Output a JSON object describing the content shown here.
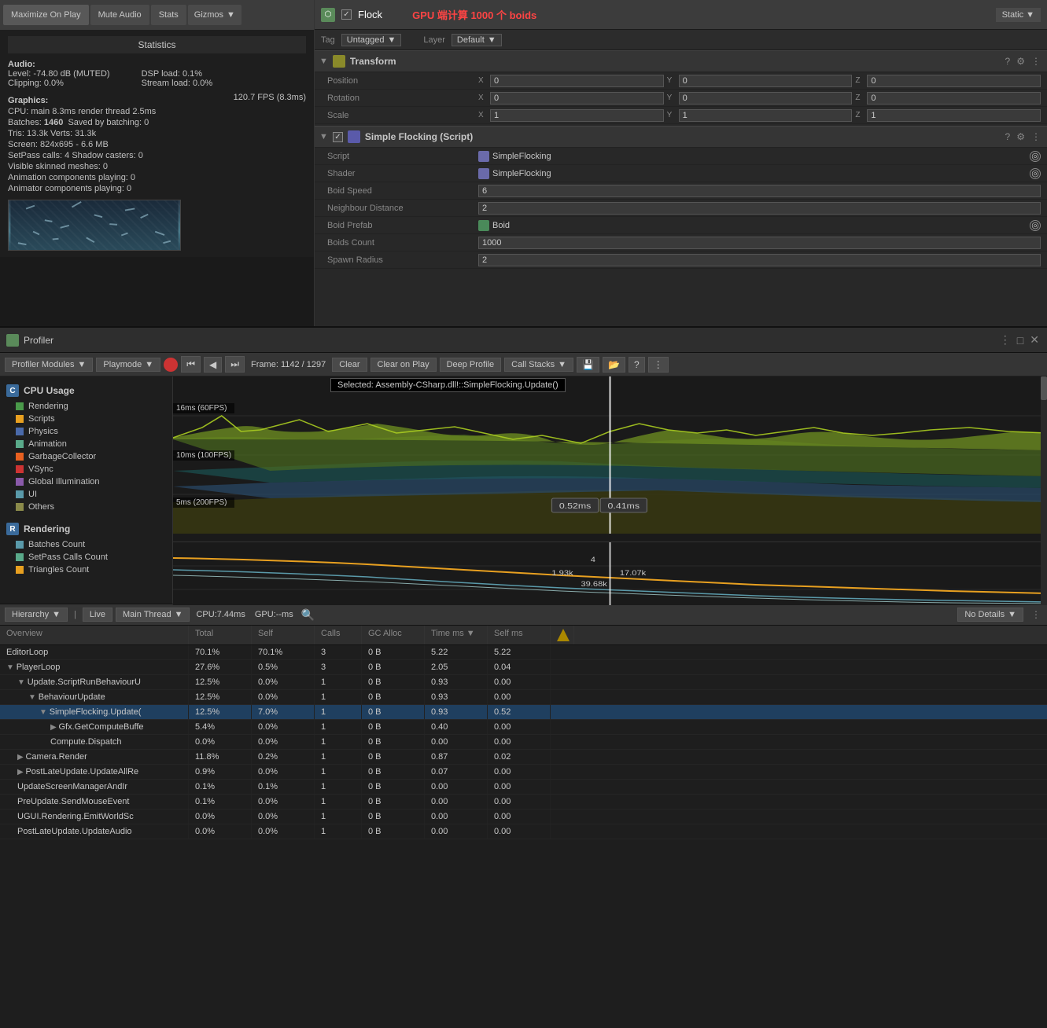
{
  "toolbar": {
    "maximize_on_play": "Maximize On Play",
    "mute_audio": "Mute Audio",
    "stats": "Stats",
    "gizmos": "Gizmos"
  },
  "statistics": {
    "title": "Statistics",
    "audio_label": "Audio:",
    "audio_level": "Level: -74.80 dB (MUTED)",
    "audio_clipping": "Clipping: 0.0%",
    "audio_dsp": "DSP load: 0.1%",
    "audio_stream": "Stream load: 0.0%",
    "graphics_label": "Graphics:",
    "graphics_fps": "120.7 FPS (8.3ms)",
    "cpu_line": "CPU: main 8.3ms  render thread 2.5ms",
    "batches_line": "Batches: 1460  Saved by batching: 0",
    "tris_verts": "Tris: 13.3k     Verts: 31.3k",
    "screen": "Screen: 824x695 - 6.6 MB",
    "setpass": "SetPass calls: 4    Shadow casters: 0",
    "visible_meshes": "Visible skinned meshes: 0",
    "animation_playing": "Animation components playing: 0",
    "animator_playing": "Animator components playing: 0"
  },
  "inspector": {
    "object_name": "Flock",
    "gpu_label": "GPU 端计算 1000 个 boids",
    "static_label": "Static",
    "tag_label": "Tag",
    "tag_value": "Untagged",
    "layer_label": "Layer",
    "layer_value": "Default",
    "transform": {
      "title": "Transform",
      "position_label": "Position",
      "rotation_label": "Rotation",
      "scale_label": "Scale",
      "pos_x": "0",
      "pos_y": "0",
      "pos_z": "0",
      "rot_x": "0",
      "rot_y": "0",
      "rot_z": "0",
      "scale_x": "1",
      "scale_y": "1",
      "scale_z": "1"
    },
    "script": {
      "title": "Simple Flocking (Script)",
      "script_label": "Script",
      "script_value": "SimpleFlocking",
      "shader_label": "Shader",
      "shader_value": "SimpleFlocking",
      "boid_speed_label": "Boid Speed",
      "boid_speed_value": "6",
      "neighbour_distance_label": "Neighbour Distance",
      "neighbour_distance_value": "2",
      "boid_prefab_label": "Boid Prefab",
      "boid_prefab_value": "Boid",
      "boids_count_label": "Boids Count",
      "boids_count_value": "1000",
      "spawn_radius_label": "Spawn Radius",
      "spawn_radius_value": "2"
    }
  },
  "profiler": {
    "title": "Profiler",
    "modules_label": "Profiler Modules",
    "playmode_label": "Playmode",
    "frame_info": "Frame: 1142 / 1297",
    "clear_label": "Clear",
    "clear_on_play_label": "Clear on Play",
    "deep_profile_label": "Deep Profile",
    "call_stacks_label": "Call Stacks",
    "selected_tooltip": "Selected: Assembly-CSharp.dll!::SimpleFlocking.Update()",
    "cpu_usage_label": "CPU Usage",
    "chart_labels": [
      "16ms (60FPS)",
      "10ms (100FPS)",
      "5ms (200FPS)"
    ],
    "chart_tooltip1": "0.52ms",
    "chart_tooltip2": "0.41ms",
    "chart_value1": "4",
    "chart_value2": "1.93k",
    "chart_value3": "17.07k",
    "chart_value4": "39.68k",
    "legend": [
      {
        "label": "Rendering",
        "color": "#4a9a4a"
      },
      {
        "label": "Scripts",
        "color": "#e8a020"
      },
      {
        "label": "Physics",
        "color": "#4a6aaa"
      },
      {
        "label": "Animation",
        "color": "#5aaa8a"
      },
      {
        "label": "GarbageCollector",
        "color": "#e86020"
      },
      {
        "label": "VSync",
        "color": "#cc3333"
      },
      {
        "label": "Global Illumination",
        "color": "#8a5aaa"
      },
      {
        "label": "UI",
        "color": "#5a9aaa"
      },
      {
        "label": "Others",
        "color": "#8a8a4a"
      }
    ],
    "rendering_label": "Rendering",
    "rendering_legend": [
      {
        "label": "Batches Count",
        "color": "#5a9aaa"
      },
      {
        "label": "SetPass Calls Count",
        "color": "#5aaa8a"
      },
      {
        "label": "Triangles Count",
        "color": "#e8a020"
      }
    ]
  },
  "hierarchy": {
    "label": "Hierarchy",
    "live_label": "Live",
    "thread_label": "Main Thread",
    "cpu_info": "CPU:7.44ms",
    "gpu_info": "GPU:--ms",
    "no_details": "No Details",
    "columns": [
      "Overview",
      "Total",
      "Self",
      "Calls",
      "GC Alloc",
      "Time ms",
      "Self ms"
    ],
    "rows": [
      {
        "name": "EditorLoop",
        "indent": 0,
        "has_arrow": false,
        "total": "70.1%",
        "self": "70.1%",
        "calls": "3",
        "gc": "0 B",
        "time": "5.22",
        "selfms": "5.22"
      },
      {
        "name": "PlayerLoop",
        "indent": 0,
        "has_arrow": true,
        "expanded": true,
        "total": "27.6%",
        "self": "0.5%",
        "calls": "3",
        "gc": "0 B",
        "time": "2.05",
        "selfms": "0.04"
      },
      {
        "name": "Update.ScriptRunBehaviourU",
        "indent": 1,
        "has_arrow": true,
        "expanded": true,
        "total": "12.5%",
        "self": "0.0%",
        "calls": "1",
        "gc": "0 B",
        "time": "0.93",
        "selfms": "0.00"
      },
      {
        "name": "BehaviourUpdate",
        "indent": 2,
        "has_arrow": true,
        "expanded": true,
        "total": "12.5%",
        "self": "0.0%",
        "calls": "1",
        "gc": "0 B",
        "time": "0.93",
        "selfms": "0.00"
      },
      {
        "name": "SimpleFlocking.Update(",
        "indent": 3,
        "has_arrow": true,
        "expanded": true,
        "total": "12.5%",
        "self": "7.0%",
        "calls": "1",
        "gc": "0 B",
        "time": "0.93",
        "selfms": "0.52"
      },
      {
        "name": "Gfx.GetComputeBuffe",
        "indent": 4,
        "has_arrow": true,
        "expanded": false,
        "total": "5.4%",
        "self": "0.0%",
        "calls": "1",
        "gc": "0 B",
        "time": "0.40",
        "selfms": "0.00"
      },
      {
        "name": "Compute.Dispatch",
        "indent": 4,
        "has_arrow": false,
        "total": "0.0%",
        "self": "0.0%",
        "calls": "1",
        "gc": "0 B",
        "time": "0.00",
        "selfms": "0.00"
      },
      {
        "name": "Camera.Render",
        "indent": 1,
        "has_arrow": true,
        "expanded": false,
        "total": "11.8%",
        "self": "0.2%",
        "calls": "1",
        "gc": "0 B",
        "time": "0.87",
        "selfms": "0.02"
      },
      {
        "name": "PostLateUpdate.UpdateAllRe",
        "indent": 1,
        "has_arrow": true,
        "expanded": false,
        "total": "0.9%",
        "self": "0.0%",
        "calls": "1",
        "gc": "0 B",
        "time": "0.07",
        "selfms": "0.00"
      },
      {
        "name": "UpdateScreenManagerAndIr",
        "indent": 1,
        "has_arrow": false,
        "total": "0.1%",
        "self": "0.1%",
        "calls": "1",
        "gc": "0 B",
        "time": "0.00",
        "selfms": "0.00"
      },
      {
        "name": "PreUpdate.SendMouseEvent",
        "indent": 1,
        "has_arrow": false,
        "total": "0.1%",
        "self": "0.0%",
        "calls": "1",
        "gc": "0 B",
        "time": "0.00",
        "selfms": "0.00"
      },
      {
        "name": "UGUI.Rendering.EmitWorldSc",
        "indent": 1,
        "has_arrow": false,
        "total": "0.0%",
        "self": "0.0%",
        "calls": "1",
        "gc": "0 B",
        "time": "0.00",
        "selfms": "0.00"
      },
      {
        "name": "PostLateUpdate.UpdateAudio",
        "indent": 1,
        "has_arrow": false,
        "total": "0.0%",
        "self": "0.0%",
        "calls": "1",
        "gc": "0 B",
        "time": "0.00",
        "selfms": "0.00"
      }
    ]
  }
}
